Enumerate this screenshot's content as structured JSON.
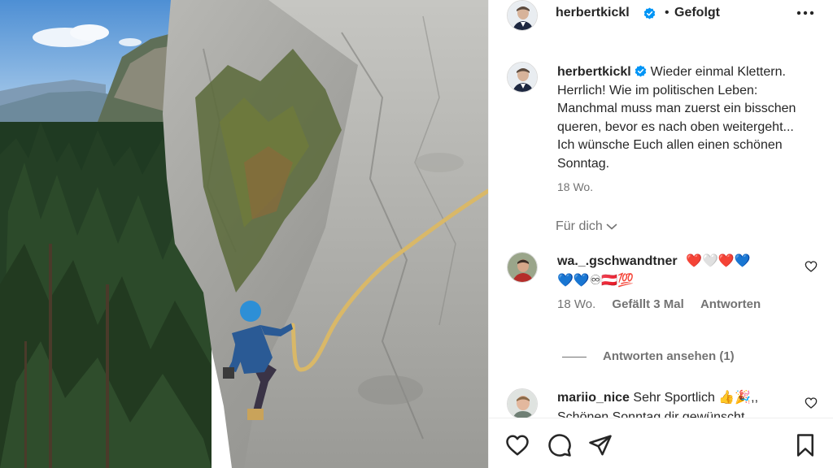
{
  "post": {
    "username": "herbertkickl",
    "separator": "•",
    "follow_status": "Gefolgt",
    "caption_text": "Wieder einmal Klettern. Herrlich! Wie im politischen Leben: Manchmal muss man zuerst ein bisschen queren, bevor es nach oben weitergeht... Ich wünsche Euch allen einen schönen Sonntag.",
    "caption_time": "18 Wo."
  },
  "comments_section": {
    "filter_label": "Für dich",
    "comments": [
      {
        "username": "wa._.gschwandtner",
        "text_line1": "❤️🤍❤️💙",
        "text_line2": "💙💙♾🇦🇹💯",
        "time": "18 Wo.",
        "likes": "Gefällt 3 Mal",
        "reply": "Antworten"
      },
      {
        "username": "mariio_nice",
        "text": "Sehr Sportlich 👍🎉,,",
        "text_line2": "Schönen Sonntag dir gewünscht"
      }
    ],
    "view_replies": "Antworten ansehen (1)"
  },
  "icons": {
    "more": "more-horizontal-icon",
    "verified": "verified-badge-icon",
    "like": "heart-icon",
    "comment": "comment-icon",
    "share": "paper-plane-icon",
    "save": "bookmark-icon"
  },
  "colors": {
    "verified": "#0095f6",
    "secondary_text": "#737373",
    "primary_text": "#262626"
  }
}
